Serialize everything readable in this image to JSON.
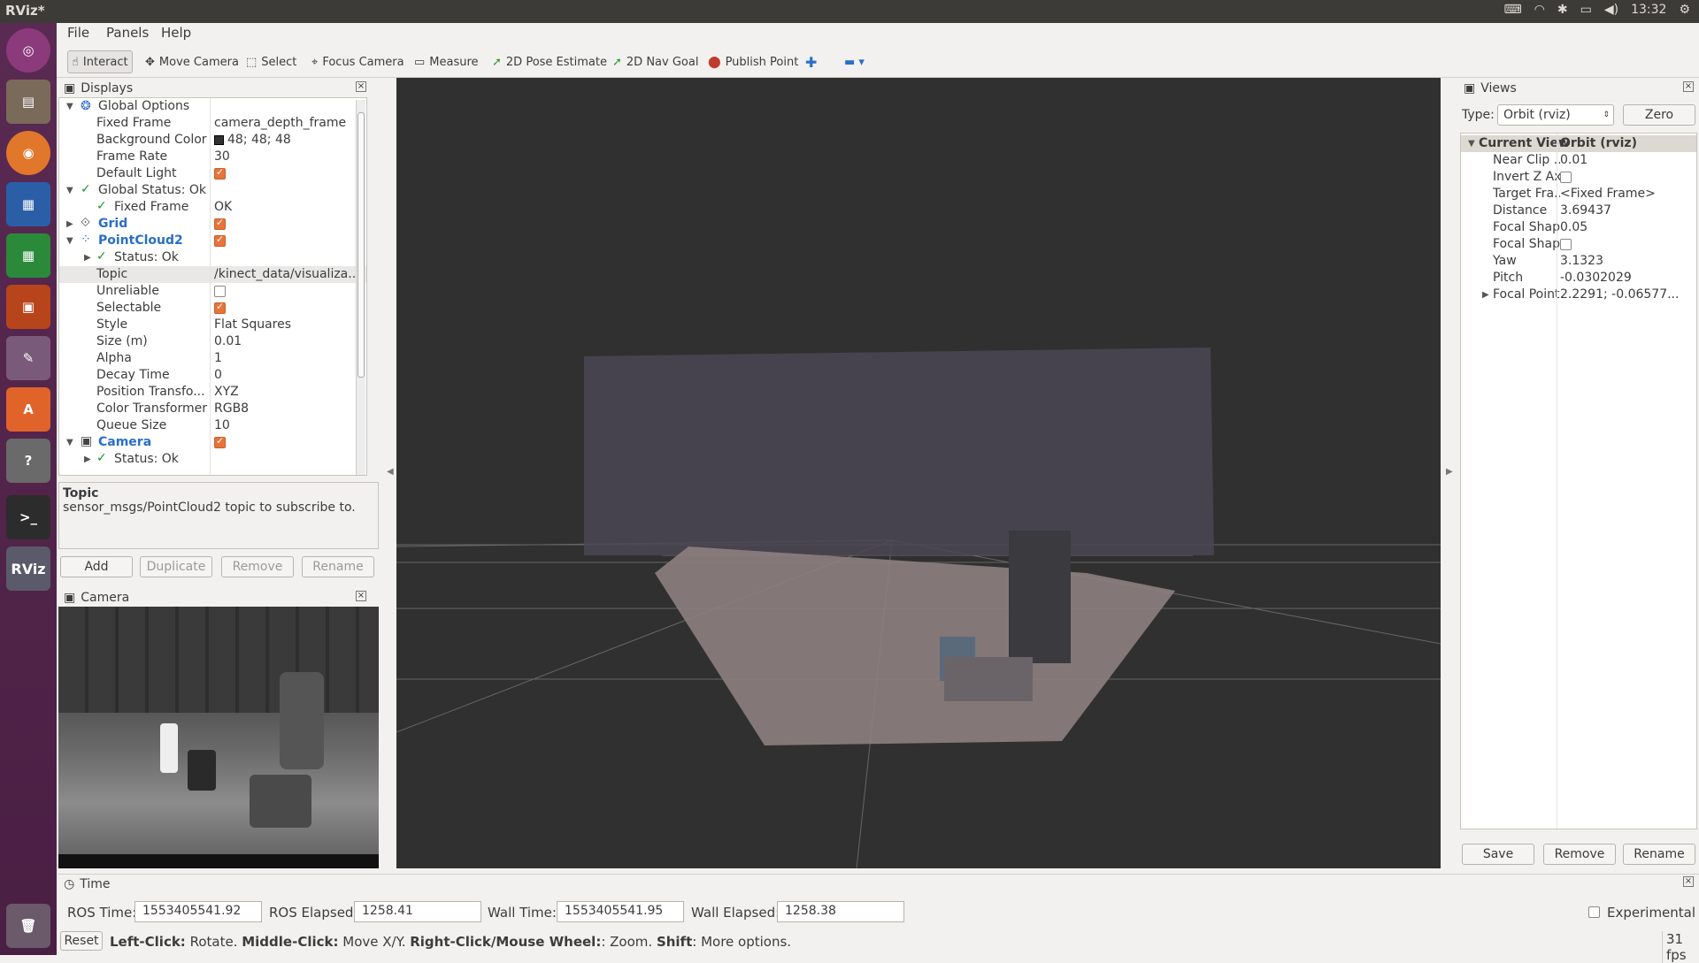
{
  "app": {
    "title": "RViz*",
    "clock": "13:32"
  },
  "menu": [
    "File",
    "Panels",
    "Help"
  ],
  "toolbar": [
    {
      "label": "Interact",
      "icon": "hand-icon"
    },
    {
      "label": "Move Camera",
      "icon": "move-icon"
    },
    {
      "label": "Select",
      "icon": "select-icon"
    },
    {
      "label": "Focus Camera",
      "icon": "focus-icon"
    },
    {
      "label": "Measure",
      "icon": "ruler-icon"
    },
    {
      "label": "2D Pose Estimate",
      "icon": "green-arrow-icon"
    },
    {
      "label": "2D Nav Goal",
      "icon": "green-arrow-icon"
    },
    {
      "label": "Publish Point",
      "icon": "pin-icon"
    }
  ],
  "displays": {
    "title": "Displays",
    "rows": [
      {
        "k": "Global Options",
        "v": ""
      },
      {
        "k": "Fixed Frame",
        "v": "camera_depth_frame"
      },
      {
        "k": "Background Color",
        "v": "48; 48; 48"
      },
      {
        "k": "Frame Rate",
        "v": "30"
      },
      {
        "k": "Default Light",
        "v": ""
      },
      {
        "k": "Global Status: Ok",
        "v": ""
      },
      {
        "k": "Fixed Frame",
        "v": "OK"
      },
      {
        "k": "Grid",
        "v": ""
      },
      {
        "k": "PointCloud2",
        "v": ""
      },
      {
        "k": "Status: Ok",
        "v": ""
      },
      {
        "k": "Topic",
        "v": "/kinect_data/visualiza..."
      },
      {
        "k": "Unreliable",
        "v": ""
      },
      {
        "k": "Selectable",
        "v": ""
      },
      {
        "k": "Style",
        "v": "Flat Squares"
      },
      {
        "k": "Size (m)",
        "v": "0.01"
      },
      {
        "k": "Alpha",
        "v": "1"
      },
      {
        "k": "Decay Time",
        "v": "0"
      },
      {
        "k": "Position Transfo...",
        "v": "XYZ"
      },
      {
        "k": "Color Transformer",
        "v": "RGB8"
      },
      {
        "k": "Queue Size",
        "v": "10"
      },
      {
        "k": "Camera",
        "v": ""
      },
      {
        "k": "Status: Ok",
        "v": ""
      }
    ]
  },
  "desc": {
    "title": "Topic",
    "text": "sensor_msgs/PointCloud2 topic to subscribe to."
  },
  "display_buttons": [
    "Add",
    "Duplicate",
    "Remove",
    "Rename"
  ],
  "camera": {
    "title": "Camera"
  },
  "views": {
    "title": "Views",
    "type_label": "Type:",
    "type_value": "Orbit (rviz)",
    "zero": "Zero",
    "header": {
      "k": "Current View",
      "v": "Orbit (rviz)"
    },
    "rows": [
      {
        "k": "Near Clip ...",
        "v": "0.01"
      },
      {
        "k": "Invert Z Axis",
        "v": ""
      },
      {
        "k": "Target Fra...",
        "v": "<Fixed Frame>"
      },
      {
        "k": "Distance",
        "v": "3.69437"
      },
      {
        "k": "Focal Shap...",
        "v": "0.05"
      },
      {
        "k": "Focal Shap...",
        "v": ""
      },
      {
        "k": "Yaw",
        "v": "3.1323"
      },
      {
        "k": "Pitch",
        "v": "-0.0302029"
      },
      {
        "k": "Focal Point",
        "v": "2.2291; -0.06577..."
      }
    ],
    "buttons": [
      "Save",
      "Remove",
      "Rename"
    ]
  },
  "time": {
    "title": "Time",
    "ros_time_label": "ROS Time:",
    "ros_time": "1553405541.92",
    "ros_elapsed_label": "ROS Elapsed:",
    "ros_elapsed": "1258.41",
    "wall_time_label": "Wall Time:",
    "wall_time": "1553405541.95",
    "wall_elapsed_label": "Wall Elapsed:",
    "wall_elapsed": "1258.38",
    "experimental": "Experimental"
  },
  "status": {
    "reset": "Reset",
    "h1": "Left-Click:",
    "t1": " Rotate. ",
    "h2": "Middle-Click:",
    "t2": " Move X/Y. ",
    "h3": "Right-Click/Mouse Wheel:",
    "t3": ": Zoom. ",
    "h4": "Shift",
    "t4": ": More options.",
    "fps": "31 fps"
  }
}
